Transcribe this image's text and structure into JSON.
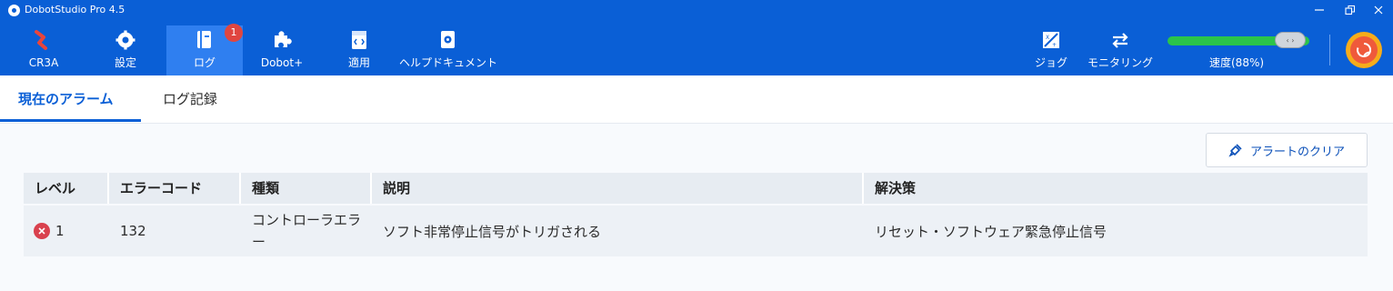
{
  "app": {
    "title": "DobotStudio Pro 4.5"
  },
  "toolbar": {
    "items": [
      {
        "label": "CR3A",
        "icon": "robot-arm-icon"
      },
      {
        "label": "設定",
        "icon": "gear-icon"
      },
      {
        "label": "ログ",
        "icon": "log-book-icon",
        "badge": "1",
        "active": true
      },
      {
        "label": "Dobot+",
        "icon": "puzzle-icon"
      },
      {
        "label": "適用",
        "icon": "code-file-icon"
      },
      {
        "label": "ヘルプドキュメント",
        "icon": "help-doc-icon"
      }
    ],
    "right": {
      "jog_label": "ジョグ",
      "monitor_label": "モニタリング",
      "speed_label": "速度(88%)",
      "speed_value": 0.88
    }
  },
  "tabs": {
    "current_alarm": "現在のアラーム",
    "log_record": "ログ記録"
  },
  "clear_button": {
    "label": "アラートのクリア"
  },
  "table": {
    "headers": [
      "レベル",
      "エラーコード",
      "種類",
      "説明",
      "解決策"
    ],
    "rows": [
      {
        "level": "1",
        "code": "132",
        "type": "コントローラエラー",
        "description": "ソフト非常停止信号がトリガされる",
        "solution": "リセット・ソフトウェア緊急停止信号"
      }
    ]
  },
  "colors": {
    "header_blue": "#0a5fd6",
    "active_tab_bg": "#2f7ff0",
    "speed_green": "#2bc44a",
    "error_red": "#d9414e",
    "power_orange": "#f6ac1b"
  }
}
